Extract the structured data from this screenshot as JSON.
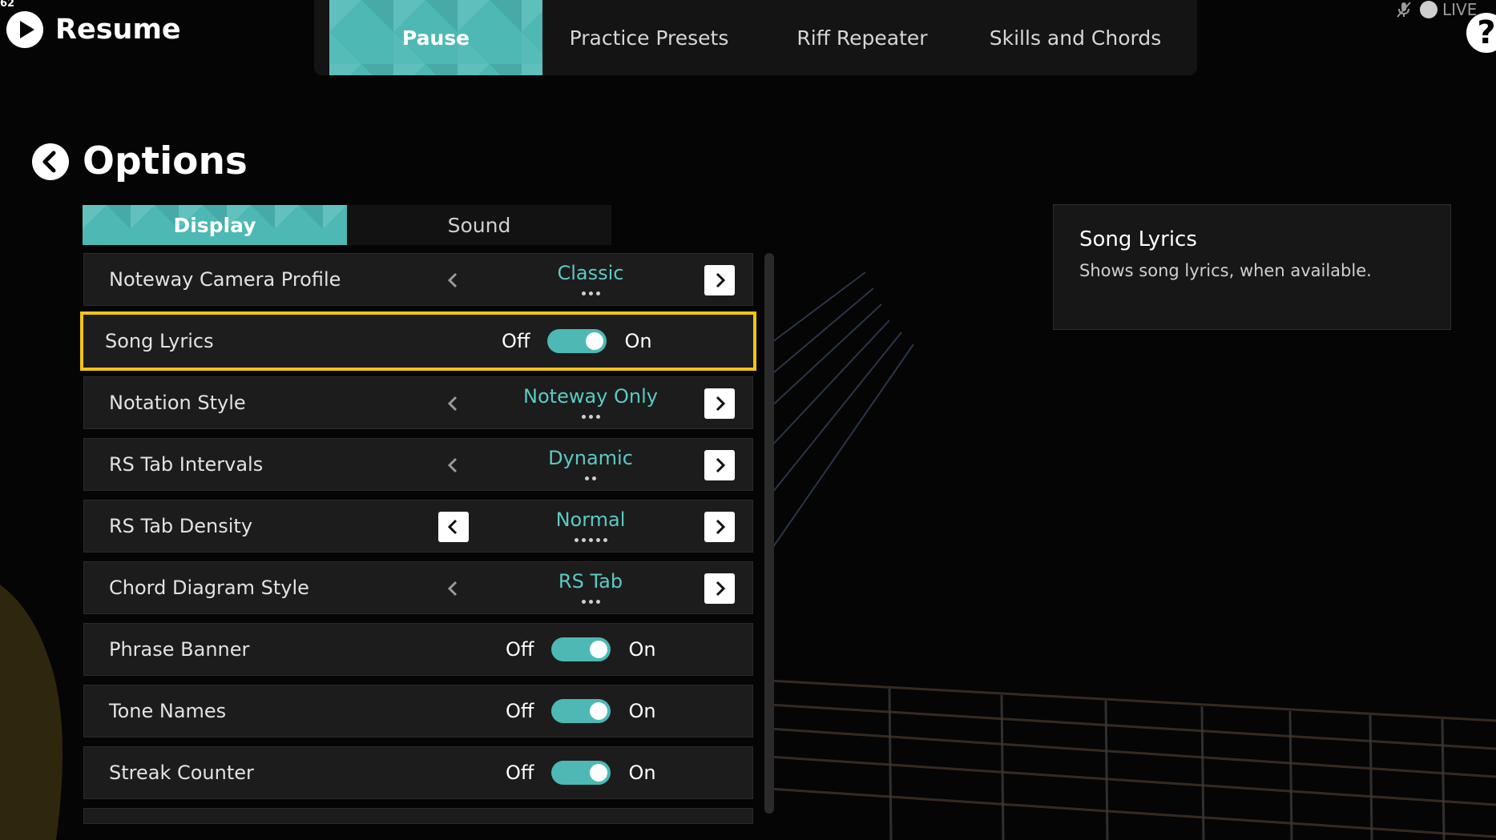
{
  "fps": "62",
  "resume": {
    "label": "Resume"
  },
  "top_nav": {
    "tabs": [
      {
        "label": "Pause",
        "active": true
      },
      {
        "label": "Practice Presets",
        "active": false
      },
      {
        "label": "Riff Repeater",
        "active": false
      },
      {
        "label": "Skills and Chords",
        "active": false
      }
    ]
  },
  "status": {
    "live_label": "LIVE",
    "help_label": "?"
  },
  "options": {
    "title": "Options"
  },
  "sub_tabs": [
    {
      "label": "Display",
      "active": true
    },
    {
      "label": "Sound",
      "active": false
    }
  ],
  "settings": [
    {
      "type": "selector",
      "label": "Noteway Camera Profile",
      "value": "Classic",
      "dots": 3,
      "left_boxed": false
    },
    {
      "type": "toggle",
      "label": "Song Lyrics",
      "off": "Off",
      "on": "On",
      "state": true,
      "selected": true
    },
    {
      "type": "selector",
      "label": "Notation Style",
      "value": "Noteway Only",
      "dots": 3,
      "left_boxed": false
    },
    {
      "type": "selector",
      "label": "RS Tab Intervals",
      "value": "Dynamic",
      "dots": 2,
      "left_boxed": false
    },
    {
      "type": "selector",
      "label": "RS Tab Density",
      "value": "Normal",
      "dots": 5,
      "left_boxed": true
    },
    {
      "type": "selector",
      "label": "Chord Diagram Style",
      "value": "RS Tab",
      "dots": 3,
      "left_boxed": false
    },
    {
      "type": "toggle",
      "label": "Phrase Banner",
      "off": "Off",
      "on": "On",
      "state": true
    },
    {
      "type": "toggle",
      "label": "Tone Names",
      "off": "Off",
      "on": "On",
      "state": true
    },
    {
      "type": "toggle",
      "label": "Streak Counter",
      "off": "Off",
      "on": "On",
      "state": true
    }
  ],
  "info": {
    "title": "Song Lyrics",
    "description": "Shows song lyrics, when available."
  },
  "colors": {
    "accent": "#4db8b4",
    "accent_text": "#5cc9c3",
    "selection": "#f2c414"
  }
}
